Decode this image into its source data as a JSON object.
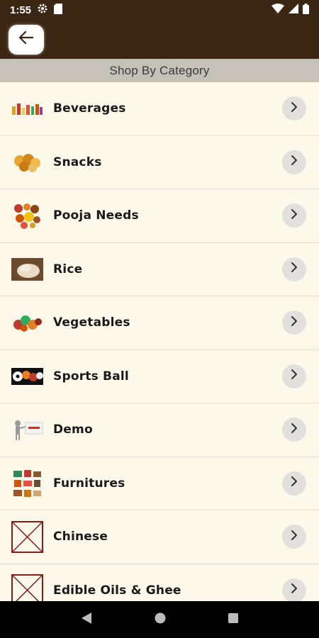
{
  "status": {
    "time": "1:55",
    "icons": [
      "gear-icon",
      "sd-card-icon",
      "wifi-icon",
      "signal-icon",
      "battery-icon"
    ]
  },
  "header": {
    "back_icon": "arrow-left-icon"
  },
  "section": {
    "title": "Shop By Category"
  },
  "categories": [
    {
      "label": "Beverages",
      "thumb": "beverages-thumbnail"
    },
    {
      "label": "Snacks",
      "thumb": "snacks-thumbnail"
    },
    {
      "label": "Pooja Needs",
      "thumb": "pooja-needs-thumbnail"
    },
    {
      "label": "Rice",
      "thumb": "rice-thumbnail"
    },
    {
      "label": "Vegetables",
      "thumb": "vegetables-thumbnail"
    },
    {
      "label": "Sports Ball",
      "thumb": "sports-ball-thumbnail"
    },
    {
      "label": "Demo",
      "thumb": "demo-thumbnail"
    },
    {
      "label": "Furnitures",
      "thumb": "furnitures-thumbnail"
    },
    {
      "label": "Chinese",
      "thumb": "broken-image-placeholder"
    },
    {
      "label": "Edible Oils & Ghee",
      "thumb": "broken-image-placeholder"
    }
  ],
  "nav": {
    "icons": [
      "back-triangle-icon",
      "home-circle-icon",
      "recents-square-icon"
    ]
  },
  "colors": {
    "app_bar": "#3b2513",
    "section_header": "#c6c1b6",
    "list_background": "#fdf9ea",
    "chevron_button": "#e2e0dc"
  }
}
